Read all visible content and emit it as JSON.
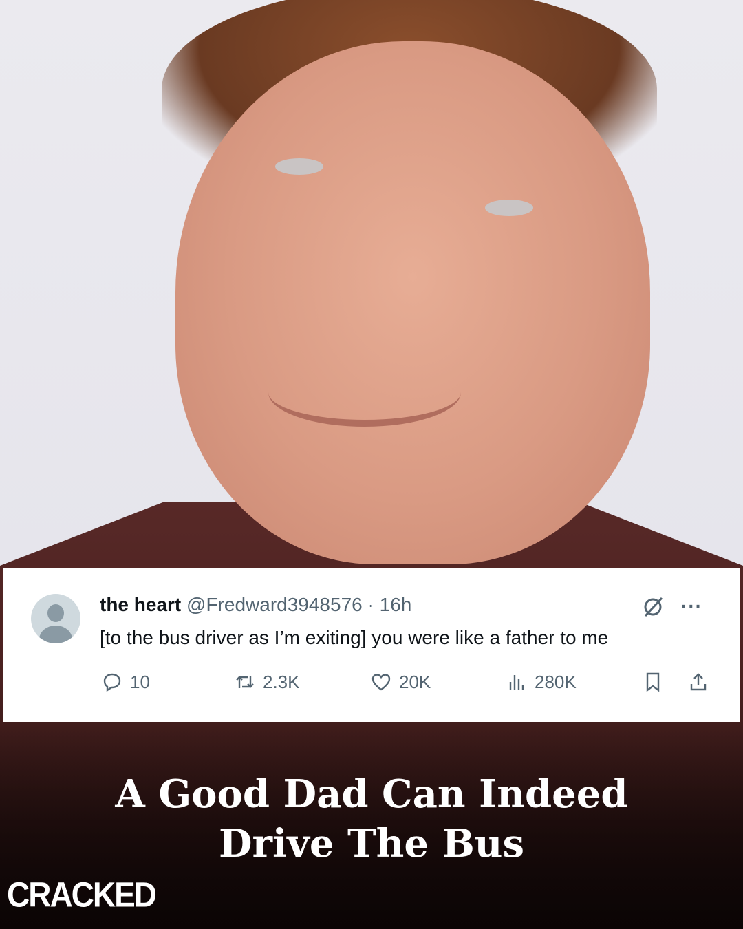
{
  "tweet": {
    "display_name": "the heart",
    "handle": "@Fredward3948576",
    "separator": "·",
    "time": "16h",
    "text": "[to the bus driver as I’m exiting] you were like a father to me",
    "more": "···",
    "replies": "10",
    "reposts": "2.3K",
    "likes": "20K",
    "views": "280K"
  },
  "headline": {
    "line1": "A Good Dad Can Indeed",
    "line2": "Drive The Bus"
  },
  "brand": "CRACKED",
  "icons": [
    "avatar-icon",
    "grok-icon",
    "more-icon",
    "reply-icon",
    "repost-icon",
    "like-icon",
    "views-icon",
    "bookmark-icon",
    "share-icon"
  ],
  "colors": {
    "tweet_bg": "#ffffff",
    "tweet_text": "#0f1419",
    "tweet_muted": "#536471",
    "headline": "#ffffff"
  }
}
